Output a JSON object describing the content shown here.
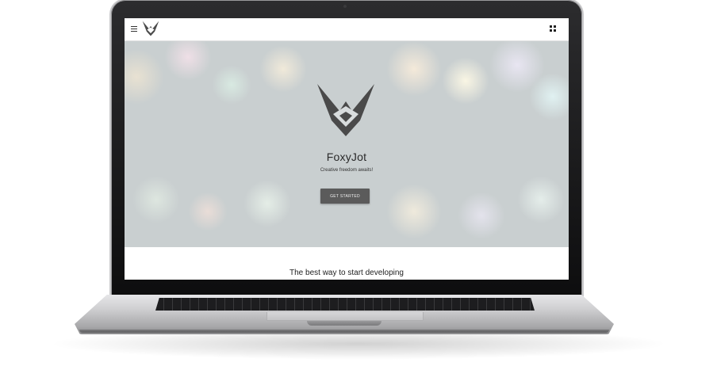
{
  "app": {
    "name": "FoxyJot",
    "tagline": "Creative freedom awaits!"
  },
  "topbar": {
    "menu_icon": "hamburger-icon",
    "logo_icon": "fox-logo-icon",
    "apps_icon": "grid-icon"
  },
  "hero": {
    "logo_icon": "fox-logo-icon",
    "cta_label": "GET STARTED",
    "background": "bokeh"
  },
  "section": {
    "title": "The best way to start developing"
  },
  "colors": {
    "button_bg": "#5b5b5b",
    "hero_bg": "#c9cfd0",
    "logo": "#4a4a4a"
  }
}
